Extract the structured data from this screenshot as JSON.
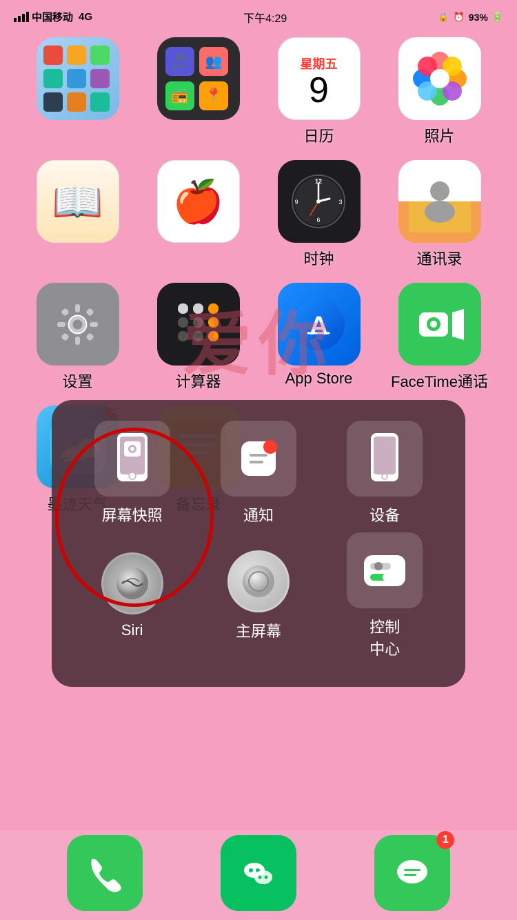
{
  "statusBar": {
    "carrier": "中国移动",
    "network": "4G",
    "time": "下午4:29",
    "battery": "93%"
  },
  "apps": [
    {
      "id": "folder1",
      "label": "",
      "type": "folder"
    },
    {
      "id": "folder2",
      "label": "",
      "type": "folder2"
    },
    {
      "id": "calendar",
      "label": "日历",
      "type": "calendar",
      "dateLabel": "星期五",
      "date": "9"
    },
    {
      "id": "photos",
      "label": "照片",
      "type": "photos"
    },
    {
      "id": "books",
      "label": "",
      "type": "books"
    },
    {
      "id": "health",
      "label": "",
      "type": "health"
    },
    {
      "id": "clock",
      "label": "时钟",
      "type": "clock"
    },
    {
      "id": "contacts",
      "label": "通讯录",
      "type": "contacts"
    },
    {
      "id": "settings",
      "label": "设置",
      "type": "settings"
    },
    {
      "id": "calculator",
      "label": "计算器",
      "type": "calculator"
    },
    {
      "id": "appstore",
      "label": "App Store",
      "type": "appstore"
    },
    {
      "id": "facetime",
      "label": "FaceTime通话",
      "type": "facetime"
    },
    {
      "id": "weather",
      "label": "墨迹天气",
      "type": "weather",
      "badge": "1"
    },
    {
      "id": "notes",
      "label": "备忘录",
      "type": "notes"
    }
  ],
  "assistiveTouch": {
    "items": [
      {
        "id": "screenshot",
        "label": "屏幕快照",
        "type": "screenshot"
      },
      {
        "id": "notification",
        "label": "通知",
        "type": "notification"
      },
      {
        "id": "device",
        "label": "设备",
        "type": "device"
      },
      {
        "id": "siri",
        "label": "Siri",
        "type": "siri"
      },
      {
        "id": "home",
        "label": "主屏幕",
        "type": "home"
      },
      {
        "id": "control",
        "label": "控制\n中心",
        "type": "control"
      }
    ]
  },
  "dock": [
    {
      "id": "phone",
      "label": "电话",
      "type": "phone"
    },
    {
      "id": "wechat",
      "label": "微信",
      "type": "wechat"
    },
    {
      "id": "messages",
      "label": "信息",
      "type": "messages",
      "badge": "1"
    }
  ]
}
